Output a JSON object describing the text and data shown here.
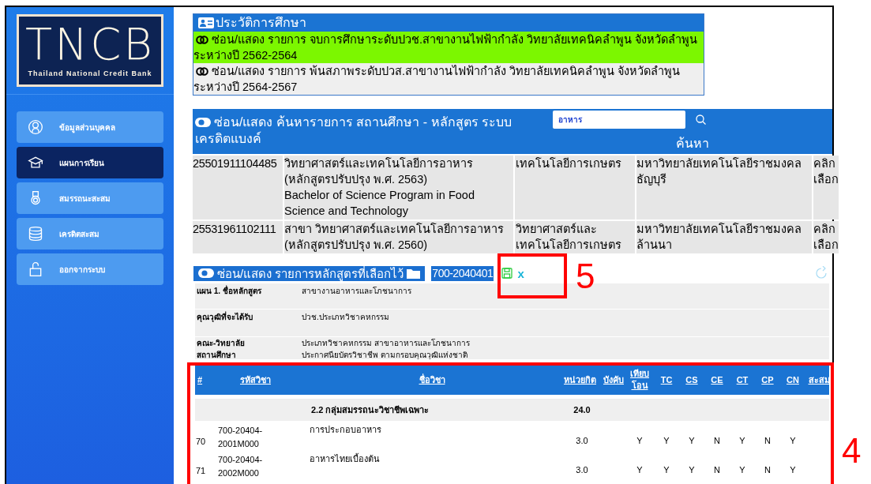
{
  "sidebar": {
    "logo": {
      "title": "TNCB",
      "subtitle": "Thailand National Credit Bank"
    },
    "items": [
      {
        "label": "ข้อมูลส่วนบุคคล",
        "selected": false
      },
      {
        "label": "แผนการเรียน",
        "selected": true
      },
      {
        "label": "สมรรถนะสะสม",
        "selected": false
      },
      {
        "label": "เครดิตสะสม",
        "selected": false
      },
      {
        "label": "ออกจากระบบ",
        "selected": false
      }
    ]
  },
  "education_history": {
    "title": "ประวัติการศึกษา",
    "entries": [
      {
        "text": "ซ่อน/แสดง รายการ จบการศึกษาระดับปวช.สาขางานไฟฟ้ากำลัง วิทยาลัยเทคนิคลำพูน จังหวัดลำพูน ระหว่างปี 2562-2564",
        "highlighted": true
      },
      {
        "text": "ซ่อน/แสดง รายการ พ้นสภาพระดับปวส.สาขางานไฟฟ้ากำลัง วิทยาลัยเทคนิคลำพูน จังหวัดลำพูน ระหว่างปี 2564-2567",
        "highlighted": false
      }
    ]
  },
  "search": {
    "title": "ซ่อน/แสดง ค้นหารายการ สถานศึกษา - หลักสูตร ระบบเครดิตแบงค์",
    "value": "อาหาร",
    "button": "ค้นหา",
    "results": [
      {
        "code": "25501911104485",
        "name": "วิทยาศาสตร์และเทคโนโลยีการอาหาร (หลักสูตรปรับปรุง พ.ศ. 2563)",
        "name_en": "Bachelor of Science Program in Food Science and Technology",
        "faculty": "เทคโนโลยีการเกษตร",
        "university": "มหาวิทยาลัยเทคโนโลยีราชมงคลธัญบุรี",
        "action": "คลิก เลือก"
      },
      {
        "code": "25531961102111",
        "name": "สาขา วิทยาศาสตร์และเทคโนโลยีการอาหาร (หลักสูตรปรับปรุง พ.ศ. 2560)",
        "faculty": "วิทยาศาสตร์และเทคโนโลยีการเกษตร",
        "university": "มหาวิทยาลัยเทคโนโลยีราชมงคลล้านนา",
        "action": "คลิก เลือก"
      }
    ]
  },
  "selected_program": {
    "title": "ซ่อน/แสดง รายการหลักสูตรที่เลือกไว้",
    "code": "700-2040401",
    "close": "x",
    "details": [
      {
        "label": "แผน 1. ชื่อหลักสูตร",
        "value": "สาขางานอาหารและโภชนาการ"
      },
      {
        "label": "คุณวุฒิที่จะได้รับ",
        "value": "ปวช.ประเภทวิชาคหกรรม"
      },
      {
        "label": "คณะ-วิทยาลัย",
        "value": "ประเภทวิชาคหกรรม สาขาอาหารและโภชนาการ"
      },
      {
        "label": "สถานศึกษา",
        "value": "ประกาศนียบัตรวิชาชีพ ตามกรอบคุณวุฒิแห่งชาติ"
      }
    ]
  },
  "courses": {
    "columns": [
      "#",
      "รหัสวิชา",
      "ชื่อวิชา",
      "หน่วยกิต",
      "บังคับ",
      "เทียบโอน",
      "TC",
      "CS",
      "CE",
      "CT",
      "CP",
      "CN",
      "สะสม"
    ],
    "rows": [
      {
        "kind": "group",
        "name": "2.2 กลุ่มสมรรถนะวิชาชีพเฉพาะ",
        "credits": "24.0"
      },
      {
        "kind": "course",
        "number": "70",
        "code": "700-20404-2001M000",
        "name": "การประกอบอาหาร",
        "credits": "3.0",
        "flags": [
          "Y",
          "Y",
          "Y",
          "N",
          "Y",
          "N",
          "Y"
        ]
      },
      {
        "kind": "course",
        "number": "71",
        "code": "700-20404-2002M000",
        "name": "อาหารไทยเบื้องต้น",
        "credits": "3.0",
        "flags": [
          "Y",
          "Y",
          "Y",
          "N",
          "Y",
          "N",
          "Y"
        ]
      }
    ]
  },
  "annotations": [
    {
      "label": "5"
    },
    {
      "label": "4"
    }
  ]
}
